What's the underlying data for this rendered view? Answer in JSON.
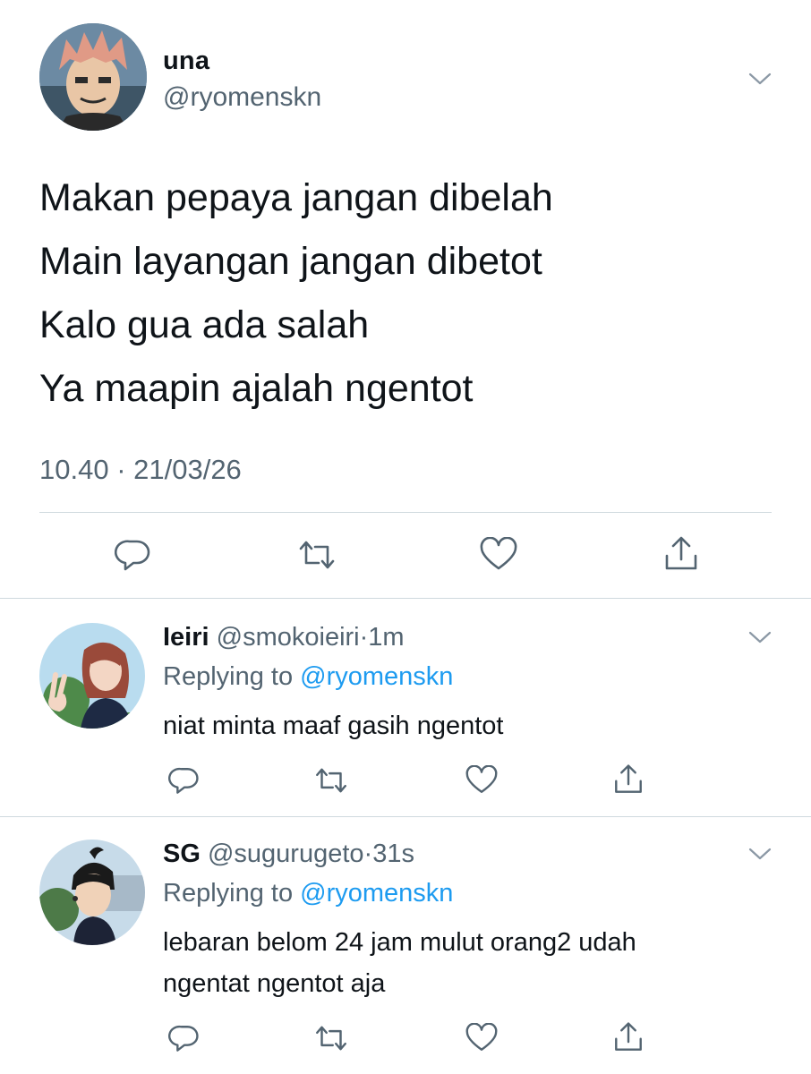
{
  "main_tweet": {
    "display_name": "una",
    "handle": "@ryomenskn",
    "lines": [
      "Makan pepaya jangan dibelah",
      "Main layangan jangan dibetot",
      "Kalo gua ada salah",
      "Ya maapin ajalah ngentot"
    ],
    "timestamp": "10.40 · 21/03/26"
  },
  "replies": [
    {
      "display_name": "Ieiri",
      "handle": "@smokoieiri",
      "time": "1m",
      "replying_prefix": "Replying to",
      "replying_to": "@ryomenskn",
      "text": "niat minta maaf gasih ngentot"
    },
    {
      "display_name": "SG",
      "handle": "@sugurugeto",
      "time": "31s",
      "replying_prefix": "Replying to",
      "replying_to": "@ryomenskn",
      "text_lines": [
        "lebaran belom 24 jam mulut orang2 udah",
        "ngentat ngentot aja"
      ]
    }
  ],
  "icons": {
    "reply": "reply-icon",
    "retweet": "retweet-icon",
    "like": "heart-icon",
    "share": "share-icon",
    "more": "chevron-down-icon"
  },
  "colors": {
    "text": "#0f1419",
    "secondary": "#536471",
    "link": "#1d9bf0",
    "divider": "#cfd9de"
  }
}
